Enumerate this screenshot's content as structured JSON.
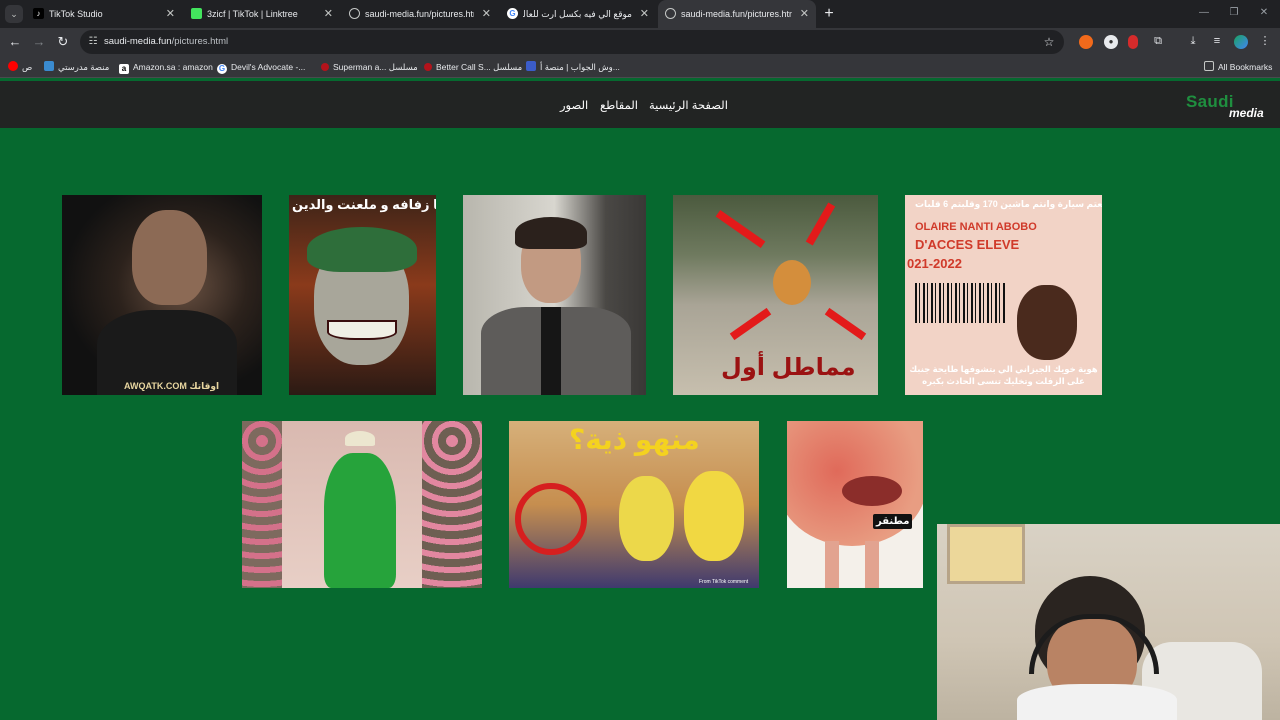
{
  "browser": {
    "tabs": [
      {
        "title": "TikTok Studio",
        "favicon": "tiktok-icon",
        "active": false
      },
      {
        "title": "3zicf | TikTok | Linktree",
        "favicon": "linktree-icon",
        "active": false
      },
      {
        "title": "saudi-media.fun/pictures.html",
        "favicon": "globe-icon",
        "active": false
      },
      {
        "title": "موقع الي فيه بكسل ارت للعالم كا",
        "favicon": "google-icon",
        "active": false
      },
      {
        "title": "saudi-media.fun/pictures.html",
        "favicon": "globe-icon",
        "active": true
      }
    ],
    "url": {
      "host": "saudi-media.fun",
      "path": "/pictures.html"
    },
    "bookmarks": [
      {
        "label": "ص",
        "icon": "youtube-icon"
      },
      {
        "label": "منصة مدرستي",
        "icon": "madrasati-icon"
      },
      {
        "label": "Amazon.sa : amazon",
        "icon": "amazon-icon"
      },
      {
        "label": "Devil's Advocate -...",
        "icon": "google-icon"
      },
      {
        "label": "Superman a... مسلسل",
        "icon": "red-icon"
      },
      {
        "label": "Better Call S... مسلسل",
        "icon": "red-icon"
      },
      {
        "label": "وش الجواب | منصة أ...",
        "icon": "blue-icon"
      }
    ],
    "all_bookmarks": "All Bookmarks"
  },
  "site": {
    "logo": {
      "line1": "Saudi",
      "line2": "media"
    },
    "nav": {
      "home": "الصفحة الرئيسية",
      "clips": "المقاطع",
      "pictures": "الصور"
    }
  },
  "pictures": {
    "p1_caption": "AWQATK.COM اوقاتك",
    "p2_caption": "نبيها زفافه و ملعنت والدين",
    "p4_caption": "مماطل أول",
    "p5_caption_top": "فيعتم سيارة وانتم ماشين 170 وقلبتم 6 قلبات",
    "p5_card_text": "D'ACCES ELEVE",
    "p5_card_year": "021-2022",
    "p5_card_top": "OLAIRE NANTI ABOBO",
    "p5_caption_bottom": "هوية خويك الجيزاني الي بتشوفها طايحة جنبك على الزفلت وتخليك تنسى الحادث بكبره",
    "p7_caption": "منهو ذية؟",
    "p7_watermark": "From TikTok comment",
    "p8_caption": "مطنقر"
  }
}
